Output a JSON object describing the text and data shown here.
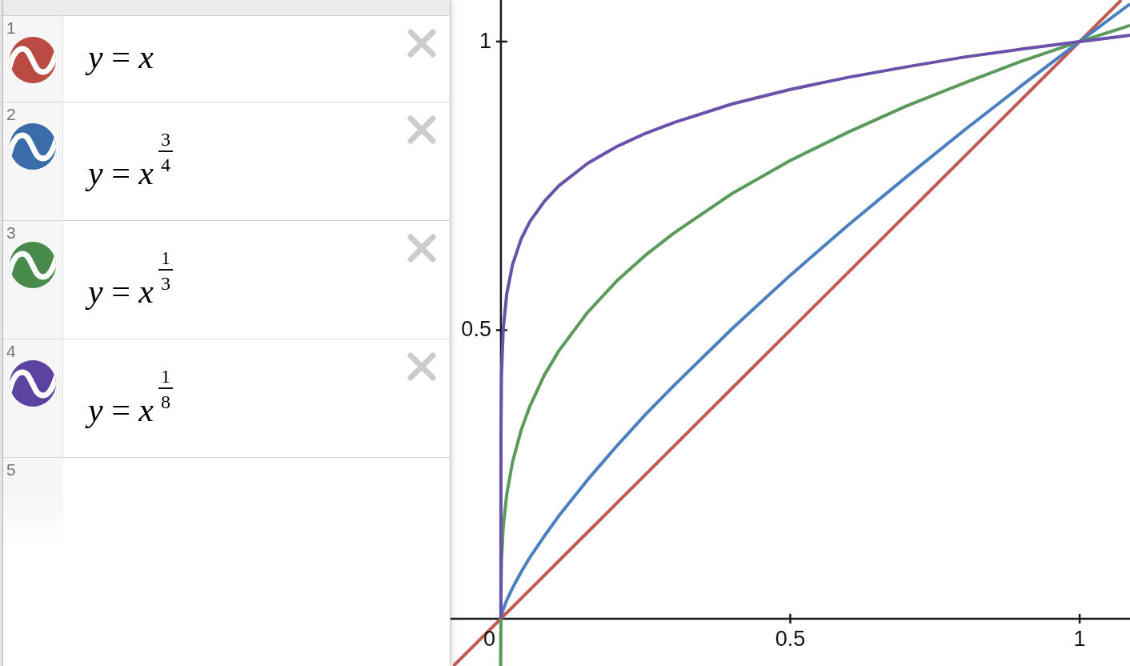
{
  "expressions": [
    {
      "number": "1",
      "kind": "plain",
      "color": "#b94b42",
      "formula": "*y* = *x*"
    },
    {
      "number": "2",
      "kind": "power",
      "color": "#3a6ca9",
      "formula": "*y* = *x*",
      "exponent": {
        "numerator": "3",
        "denominator": "4"
      }
    },
    {
      "number": "3",
      "kind": "power",
      "color": "#488a49",
      "formula": "*y* = *x*",
      "exponent": {
        "numerator": "1",
        "denominator": "3"
      }
    },
    {
      "number": "4",
      "kind": "power",
      "color": "#5c42a1",
      "formula": "*y* = *x*",
      "exponent": {
        "numerator": "1",
        "denominator": "8"
      }
    },
    {
      "number": "5",
      "kind": "empty"
    }
  ],
  "graph": {
    "chart_data": {
      "type": "line",
      "x": [
        -0.082,
        -0.00055,
        0,
        1e-06,
        0.0001,
        0.001,
        0.004,
        0.01,
        0.02,
        0.035,
        0.05,
        0.075,
        0.1,
        0.15,
        0.2,
        0.25,
        0.3,
        0.4,
        0.5,
        0.6,
        0.7,
        0.8,
        0.9,
        1,
        1.072,
        1.087
      ],
      "series": [
        {
          "color": "#c35a50",
          "values": [
            -0.082,
            null,
            0,
            null,
            null,
            0.001,
            0.004,
            0.01,
            0.02,
            0.035,
            0.05,
            0.075,
            0.1,
            0.15,
            0.2,
            0.25,
            0.3,
            0.4,
            0.5,
            0.6,
            0.7,
            0.8,
            0.9,
            1,
            1.072,
            null
          ]
        },
        {
          "color": "#4a80c0",
          "values": [
            null,
            null,
            0,
            0,
            0.001,
            0.006,
            0.016,
            0.032,
            0.053,
            0.081,
            0.106,
            0.143,
            0.178,
            0.241,
            0.299,
            0.354,
            0.405,
            0.503,
            0.595,
            0.682,
            0.765,
            0.846,
            0.924,
            1,
            1.054,
            1.065
          ]
        },
        {
          "color": "#5a9a5a",
          "values": [
            null,
            -0.082,
            0,
            0.01,
            0.046,
            0.1,
            0.159,
            0.215,
            0.271,
            0.327,
            0.368,
            0.422,
            0.464,
            0.531,
            0.585,
            0.63,
            0.669,
            0.737,
            0.794,
            0.843,
            0.888,
            0.928,
            0.966,
            1,
            1.023,
            1.028
          ]
        },
        {
          "color": "#6a52ab",
          "values": [
            null,
            null,
            0,
            0.178,
            0.316,
            0.422,
            0.502,
            0.562,
            0.613,
            0.658,
            0.688,
            0.723,
            0.75,
            0.789,
            0.818,
            0.841,
            0.86,
            0.892,
            0.917,
            0.938,
            0.956,
            0.973,
            0.987,
            1,
            1.009,
            1.011
          ]
        }
      ],
      "xlim": [
        -0.087,
        1.087
      ],
      "ylim": [
        -0.082,
        1.072
      ],
      "xticks": [
        0,
        0.5,
        1
      ],
      "yticks": [
        0.5,
        1
      ]
    }
  }
}
